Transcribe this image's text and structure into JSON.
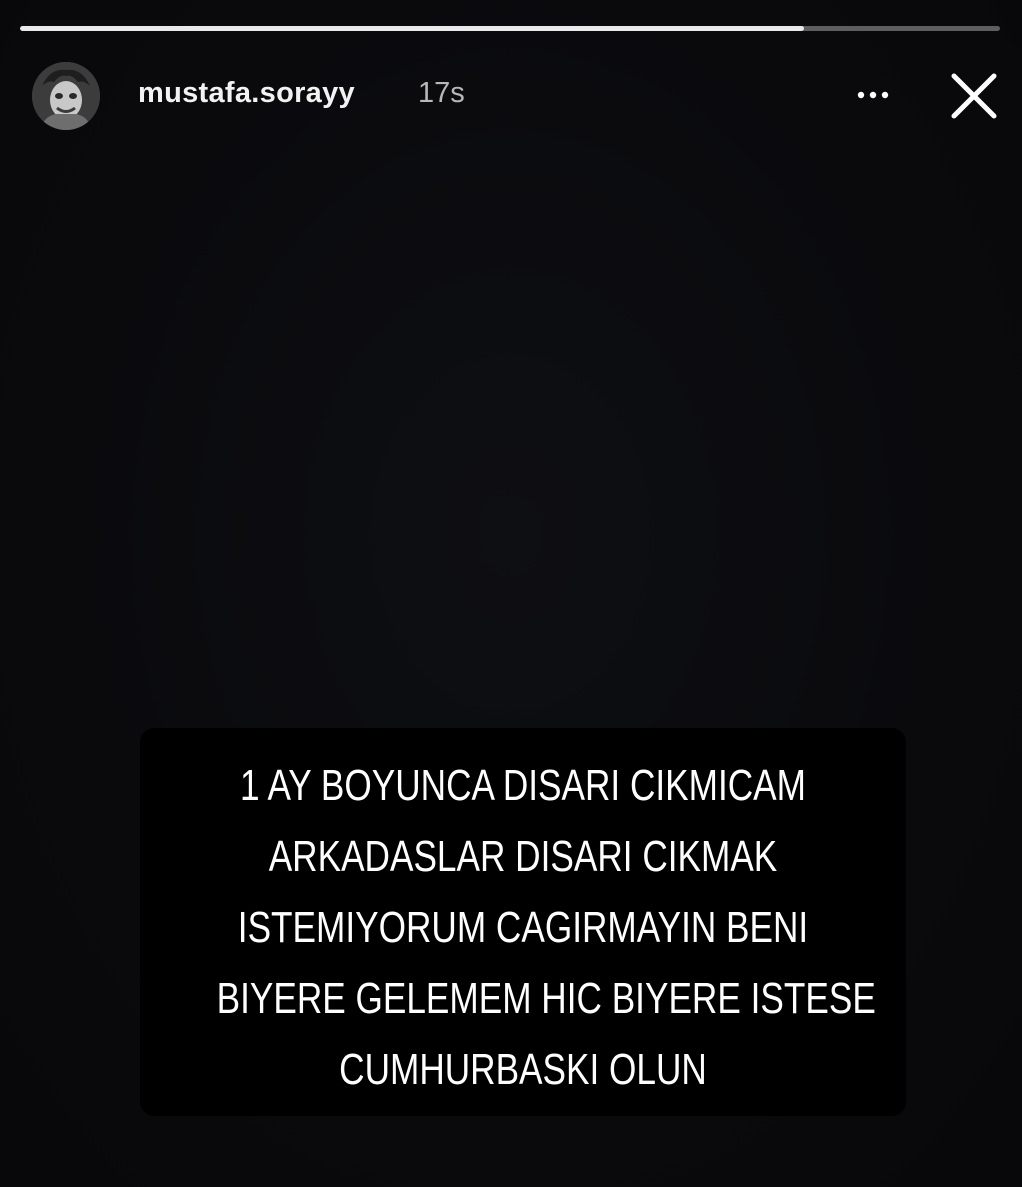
{
  "story": {
    "progress_fraction": 0.8,
    "user": {
      "username": "mustafa.sorayy",
      "timestamp": "17s",
      "avatar_icon": "avatar-icon"
    },
    "header_icons": {
      "more": "more-options-icon",
      "close": "close-icon"
    },
    "caption_lines": [
      "1 AY BOYUNCA DISARI CIKMICAM",
      "ARKADASLAR DISARI CIKMAK",
      "ISTEMIYORUM CAGIRMAYIN BENI",
      "BIYERE GELEMEM HIC BIYERE ISTESE",
      "CUMHURBASKI OLUN"
    ],
    "colors": {
      "background": "#0b0b0e",
      "caption_background": "#000000",
      "text": "#ffffff"
    }
  }
}
